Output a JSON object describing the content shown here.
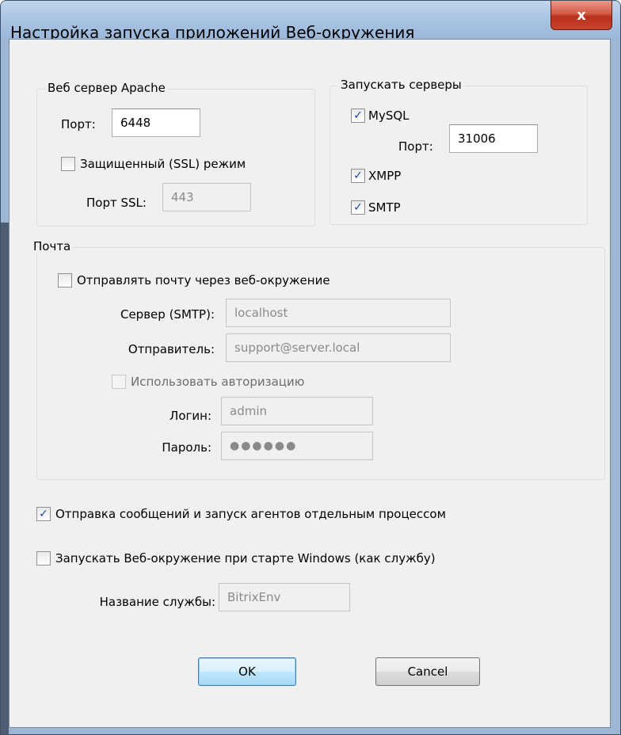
{
  "window": {
    "title": "Настройка запуска приложений Веб-окружения",
    "close_label": "x"
  },
  "apache": {
    "legend": "Веб сервер Apache",
    "port_label": "Порт:",
    "port_value": "6448",
    "ssl_checkbox_label": "Защищенный (SSL) режим",
    "ssl_checked": false,
    "ssl_port_label": "Порт SSL:",
    "ssl_port_value": "443"
  },
  "servers": {
    "legend": "Запускать серверы",
    "mysql_label": "MySQL",
    "mysql_checked": true,
    "mysql_port_label": "Порт:",
    "mysql_port_value": "31006",
    "xmpp_label": "XMPP",
    "xmpp_checked": true,
    "smtp_label": "SMTP",
    "smtp_checked": true
  },
  "mail": {
    "legend": "Почта",
    "send_label": "Отправлять почту через веб-окружение",
    "send_checked": false,
    "server_label": "Сервер (SMTP):",
    "server_value": "localhost",
    "sender_label": "Отправитель:",
    "sender_value": "support@server.local",
    "auth_label": "Использовать авторизацию",
    "auth_checked": false,
    "login_label": "Логин:",
    "login_value": "admin",
    "password_label": "Пароль:",
    "password_value": "●●●●●●"
  },
  "options": {
    "agents_label": "Отправка сообщений и запуск агентов отдельным процессом",
    "agents_checked": true,
    "service_label": "Запускать Веб-окружение при старте Windows (как службу)",
    "service_checked": false,
    "service_name_label": "Название службы:",
    "service_name_value": "BitrixEnv"
  },
  "buttons": {
    "ok": "OK",
    "cancel": "Cancel"
  },
  "icons": {
    "check": "checkmark-icon",
    "close": "close-icon"
  }
}
